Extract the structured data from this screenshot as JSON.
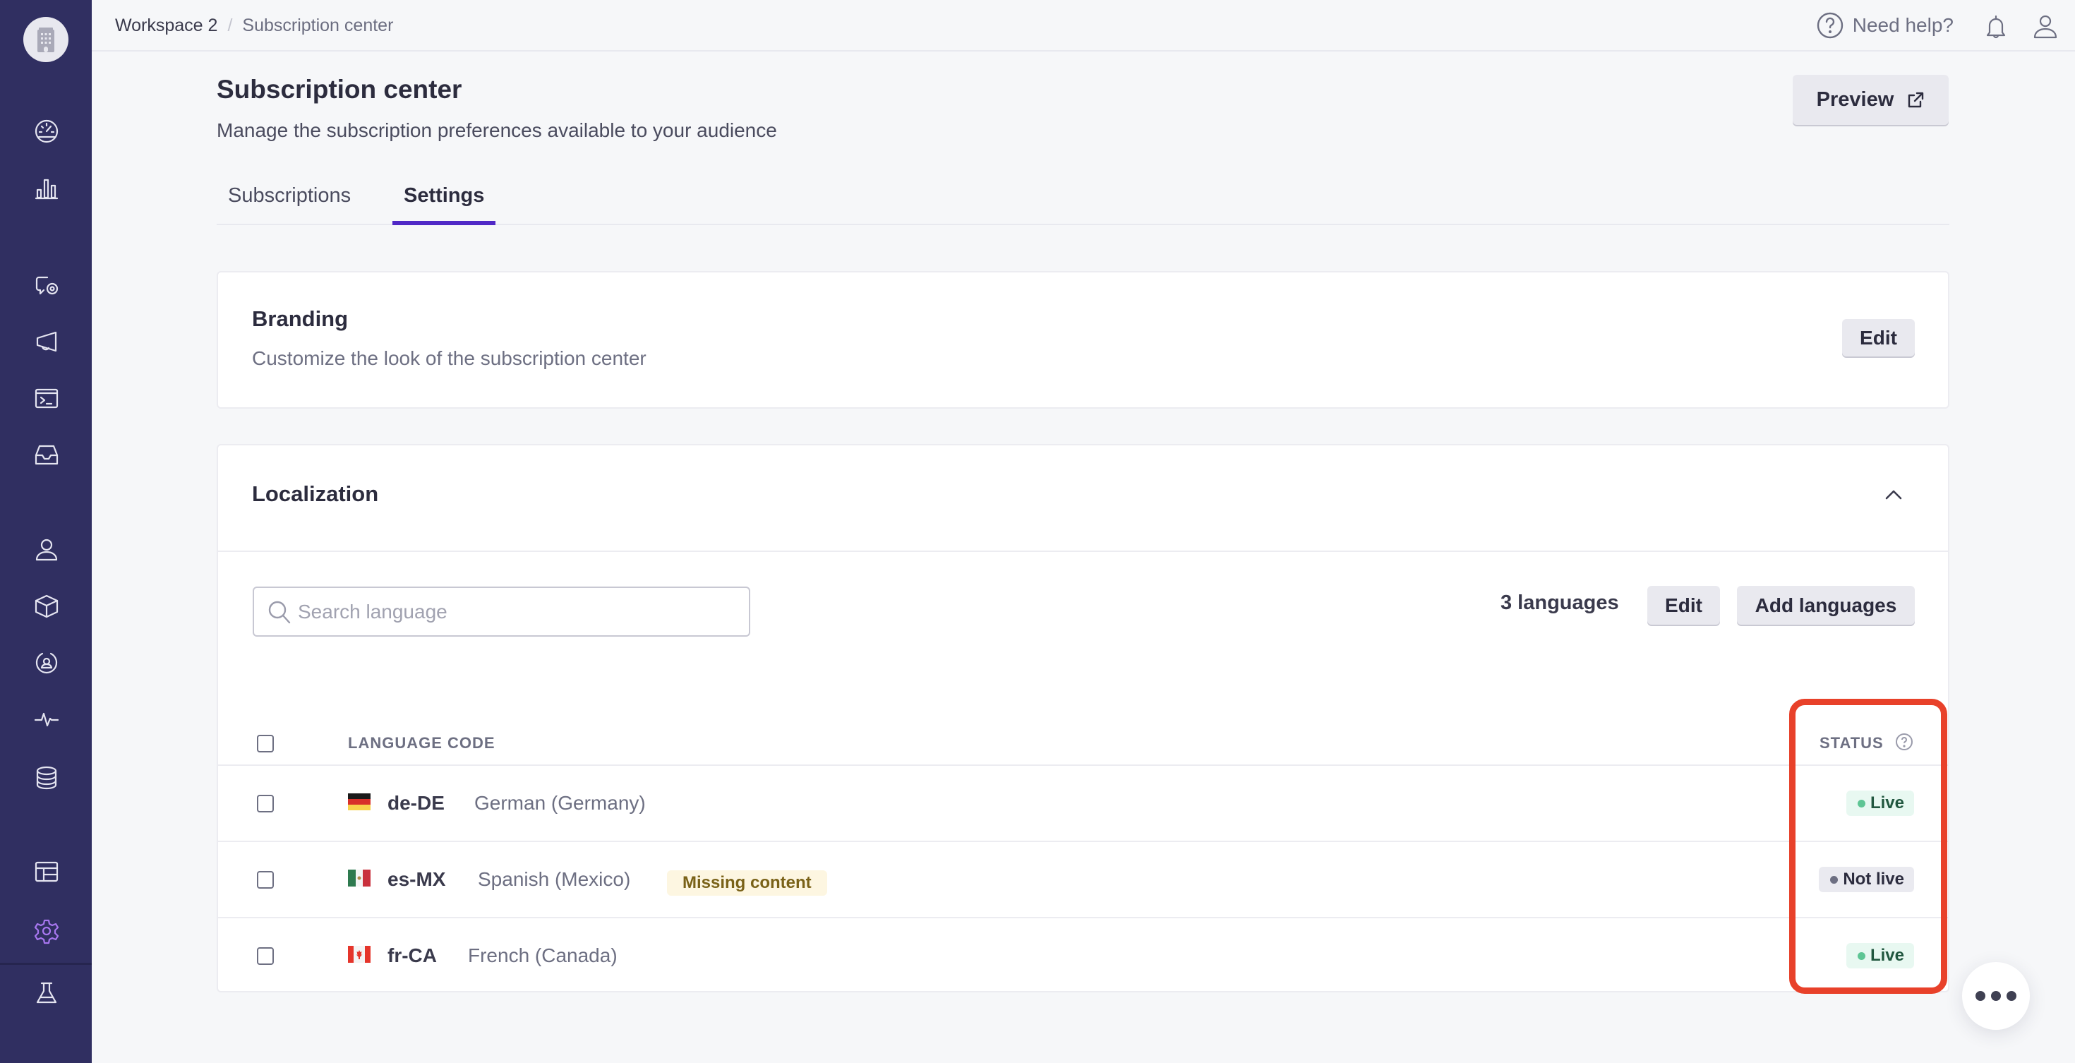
{
  "sidebar": {
    "workspace_icon": "building-icon",
    "items": [
      {
        "icon": "dashboard-gauge-icon",
        "active": false
      },
      {
        "icon": "bar-chart-icon",
        "active": false
      },
      {
        "icon": "message-eye-icon",
        "active": false
      },
      {
        "icon": "megaphone-icon",
        "active": false
      },
      {
        "icon": "terminal-icon",
        "active": false
      },
      {
        "icon": "inbox-icon",
        "active": false
      },
      {
        "icon": "user-icon",
        "active": false
      },
      {
        "icon": "cube-icon",
        "active": false
      },
      {
        "icon": "user-circle-icon",
        "active": false
      },
      {
        "icon": "activity-pulse-icon",
        "active": false
      },
      {
        "icon": "database-icon",
        "active": false
      },
      {
        "icon": "layout-table-icon",
        "active": false
      },
      {
        "icon": "gear-icon",
        "active": true
      },
      {
        "icon": "flask-icon",
        "active": false
      }
    ]
  },
  "header": {
    "breadcrumb": [
      "Workspace 2",
      "Subscription center"
    ],
    "breadcrumb_separator": "/",
    "help_label": "Need help?"
  },
  "page": {
    "title": "Subscription center",
    "subtitle": "Manage the subscription preferences available to your audience",
    "preview_label": "Preview",
    "tabs": [
      {
        "label": "Subscriptions",
        "active": false
      },
      {
        "label": "Settings",
        "active": true
      }
    ]
  },
  "branding": {
    "title": "Branding",
    "description": "Customize the look of the subscription center",
    "edit_label": "Edit"
  },
  "localization": {
    "title": "Localization",
    "expanded": true,
    "search_placeholder": "Search language",
    "search_value": "",
    "count_label": "3 languages",
    "edit_label": "Edit",
    "add_label": "Add languages",
    "columns": {
      "language_code": "LANGUAGE CODE",
      "status": "STATUS"
    },
    "rows": [
      {
        "flag": "germany-flag",
        "code": "de-DE",
        "name": "German (Germany)",
        "badge": null,
        "status": "Live"
      },
      {
        "flag": "mexico-flag",
        "code": "es-MX",
        "name": "Spanish (Mexico)",
        "badge": "Missing content",
        "status": "Not live"
      },
      {
        "flag": "canada-flag",
        "code": "fr-CA",
        "name": "French (Canada)",
        "badge": null,
        "status": "Live"
      }
    ]
  },
  "colors": {
    "sidebar_bg": "#302f61",
    "accent": "#5028c6",
    "active_icon": "#a877f0",
    "live_dot": "#5ec594",
    "highlight": "#e8412a",
    "warning_bg": "#fdf6e1"
  }
}
